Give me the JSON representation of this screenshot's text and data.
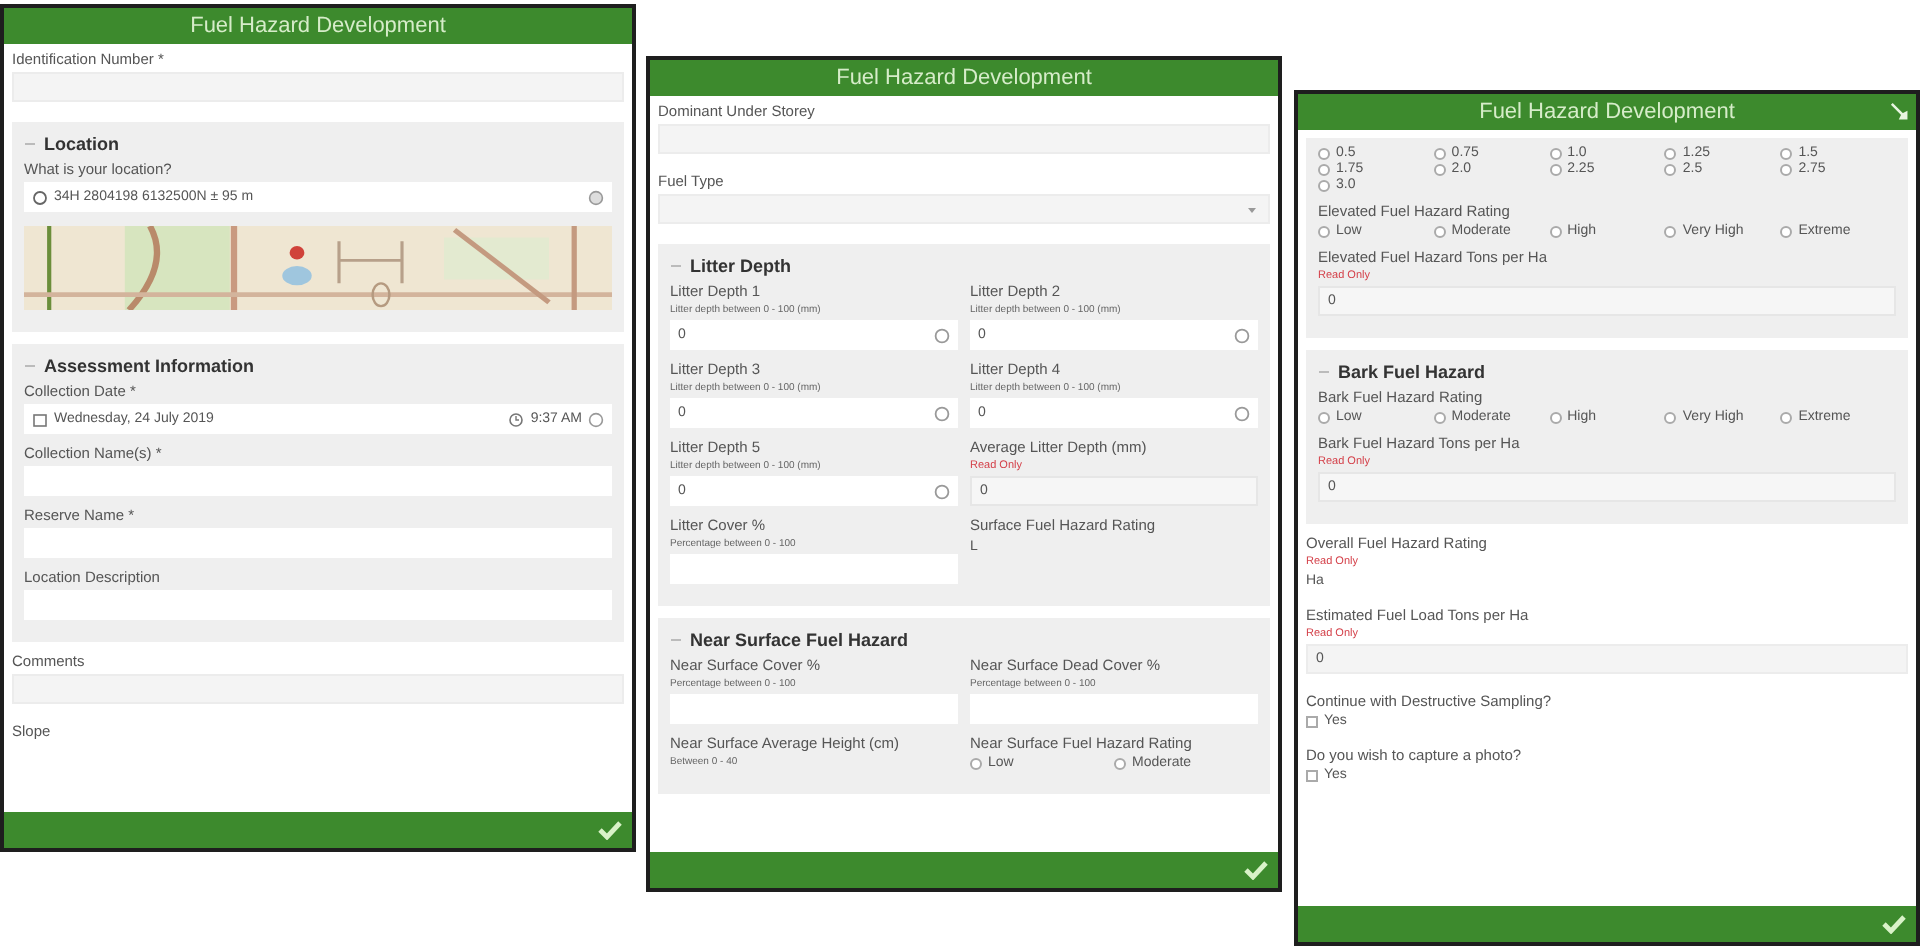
{
  "panels": [
    {
      "title": "Fuel Hazard Development",
      "items": [
        {
          "kind": "input",
          "label": "Identification Number *"
        },
        {
          "kind": "section",
          "title": "Location",
          "expanded": true,
          "items": [
            {
              "kind": "location",
              "label": "What is your location?",
              "value": "34H 2804198 6132500N ± 95 m"
            },
            {
              "kind": "picture"
            }
          ]
        },
        {
          "kind": "section",
          "title": "Assessment Information",
          "expanded": true,
          "items": [
            {
              "kind": "datetime",
              "label": "Collection Date *",
              "date": "Wednesday, 24 July 2019",
              "time": "9:37 AM"
            },
            {
              "kind": "input",
              "label": "Collection Name(s) *"
            },
            {
              "kind": "input",
              "label": "Reserve Name *"
            },
            {
              "kind": "input",
              "label": "Location Description"
            }
          ]
        },
        {
          "kind": "input",
          "label": "Comments"
        },
        {
          "kind": "label",
          "label": "Slope"
        }
      ]
    },
    {
      "title": "Fuel Hazard Development",
      "items": [
        {
          "kind": "input",
          "label": "Dominant Under Storey"
        },
        {
          "kind": "select",
          "label": "Fuel Type"
        },
        {
          "kind": "section",
          "title": "Litter Depth",
          "expanded": true,
          "items": [
            {
              "kind": "row",
              "cells": [
                {
                  "kind": "input",
                  "label": "Litter Depth 1",
                  "hint": "Litter depth between 0 - 100 (mm)",
                  "value": "0",
                  "clearable": true
                },
                {
                  "kind": "input",
                  "label": "Litter Depth 2",
                  "hint": "Litter depth between 0 - 100 (mm)",
                  "value": "0",
                  "clearable": true
                }
              ]
            },
            {
              "kind": "row",
              "cells": [
                {
                  "kind": "input",
                  "label": "Litter Depth 3",
                  "hint": "Litter depth between 0 - 100 (mm)",
                  "value": "0",
                  "clearable": true
                },
                {
                  "kind": "input",
                  "label": "Litter Depth 4",
                  "hint": "Litter depth between 0 - 100 (mm)",
                  "value": "0",
                  "clearable": true
                }
              ]
            },
            {
              "kind": "row",
              "cells": [
                {
                  "kind": "input",
                  "label": "Litter Depth 5",
                  "hint": "Litter depth between 0 - 100 (mm)",
                  "value": "0",
                  "clearable": true
                },
                {
                  "kind": "input",
                  "label": "Average Litter Depth (mm)",
                  "note": "Read Only",
                  "value": "0"
                }
              ]
            },
            {
              "kind": "row",
              "cells": [
                {
                  "kind": "input",
                  "label": "Litter Cover %",
                  "hint": "Percentage between 0 - 100"
                },
                {
                  "kind": "display",
                  "label": "Surface Fuel Hazard Rating",
                  "value": "L"
                }
              ]
            }
          ]
        },
        {
          "kind": "section",
          "title": "Near Surface Fuel Hazard",
          "expanded": true,
          "items": [
            {
              "kind": "row",
              "cells": [
                {
                  "kind": "input",
                  "label": "Near Surface Cover %",
                  "hint": "Percentage between 0 - 100"
                },
                {
                  "kind": "input",
                  "label": "Near Surface Dead Cover %",
                  "hint": "Percentage between 0 - 100"
                }
              ]
            },
            {
              "kind": "row",
              "cells": [
                {
                  "kind": "label",
                  "label": "Near Surface Average Height (cm)",
                  "hint": "Between 0 - 40"
                },
                {
                  "kind": "radio",
                  "label": "Near Surface Fuel Hazard Rating",
                  "options": [
                    {
                      "label": "Low",
                      "selected": false
                    },
                    {
                      "label": "Moderate",
                      "selected": false
                    }
                  ]
                }
              ]
            }
          ]
        }
      ]
    },
    {
      "title": "Fuel Hazard Development",
      "edit_button": true,
      "items": [
        {
          "kind": "section",
          "items": [
            {
              "kind": "radio",
              "options": [
                {
                  "label": "0.5",
                  "selected": false
                },
                {
                  "label": "0.75",
                  "selected": false
                },
                {
                  "label": "1.0",
                  "selected": false
                },
                {
                  "label": "1.25",
                  "selected": false
                },
                {
                  "label": "1.5",
                  "selected": false
                },
                {
                  "label": "1.75",
                  "selected": false
                },
                {
                  "label": "2.0",
                  "selected": false
                },
                {
                  "label": "2.25",
                  "selected": false
                },
                {
                  "label": "2.5",
                  "selected": false
                },
                {
                  "label": "2.75",
                  "selected": false
                },
                {
                  "label": "3.0",
                  "selected": false
                }
              ]
            },
            {
              "kind": "radio",
              "label": "Elevated Fuel Hazard Rating",
              "options": [
                {
                  "label": "Low",
                  "selected": false
                },
                {
                  "label": "Moderate",
                  "selected": false
                },
                {
                  "label": "High",
                  "selected": false
                },
                {
                  "label": "Very High",
                  "selected": false
                },
                {
                  "label": "Extreme",
                  "selected": false
                }
              ]
            },
            {
              "kind": "input",
              "label": "Elevated Fuel Hazard Tons per Ha",
              "note": "Read Only",
              "value": "0"
            }
          ]
        },
        {
          "kind": "section",
          "title": "Bark Fuel Hazard",
          "expanded": true,
          "items": [
            {
              "kind": "radio",
              "label": "Bark Fuel Hazard Rating",
              "options": [
                {
                  "label": "Low",
                  "selected": false
                },
                {
                  "label": "Moderate",
                  "selected": false
                },
                {
                  "label": "High",
                  "selected": false
                },
                {
                  "label": "Very High",
                  "selected": false
                },
                {
                  "label": "Extreme",
                  "selected": false
                }
              ]
            },
            {
              "kind": "input",
              "label": "Bark Fuel Hazard Tons per Ha",
              "note": "Read Only",
              "value": "0"
            }
          ]
        },
        {
          "kind": "display",
          "label": "Overall Fuel Hazard Rating",
          "note": "Read Only",
          "value": "Ha"
        },
        {
          "kind": "input",
          "label": "Estimated Fuel Load Tons per Ha",
          "note": "Read Only",
          "value": "0"
        },
        {
          "kind": "checkbox",
          "label": "Continue with Destructive Sampling?",
          "options": [
            {
              "label": "Yes",
              "selected": false
            }
          ]
        },
        {
          "kind": "checkbox",
          "label": "Do you wish to capture a photo?",
          "options": [
            {
              "label": "Yes",
              "selected": false
            }
          ]
        }
      ]
    }
  ]
}
